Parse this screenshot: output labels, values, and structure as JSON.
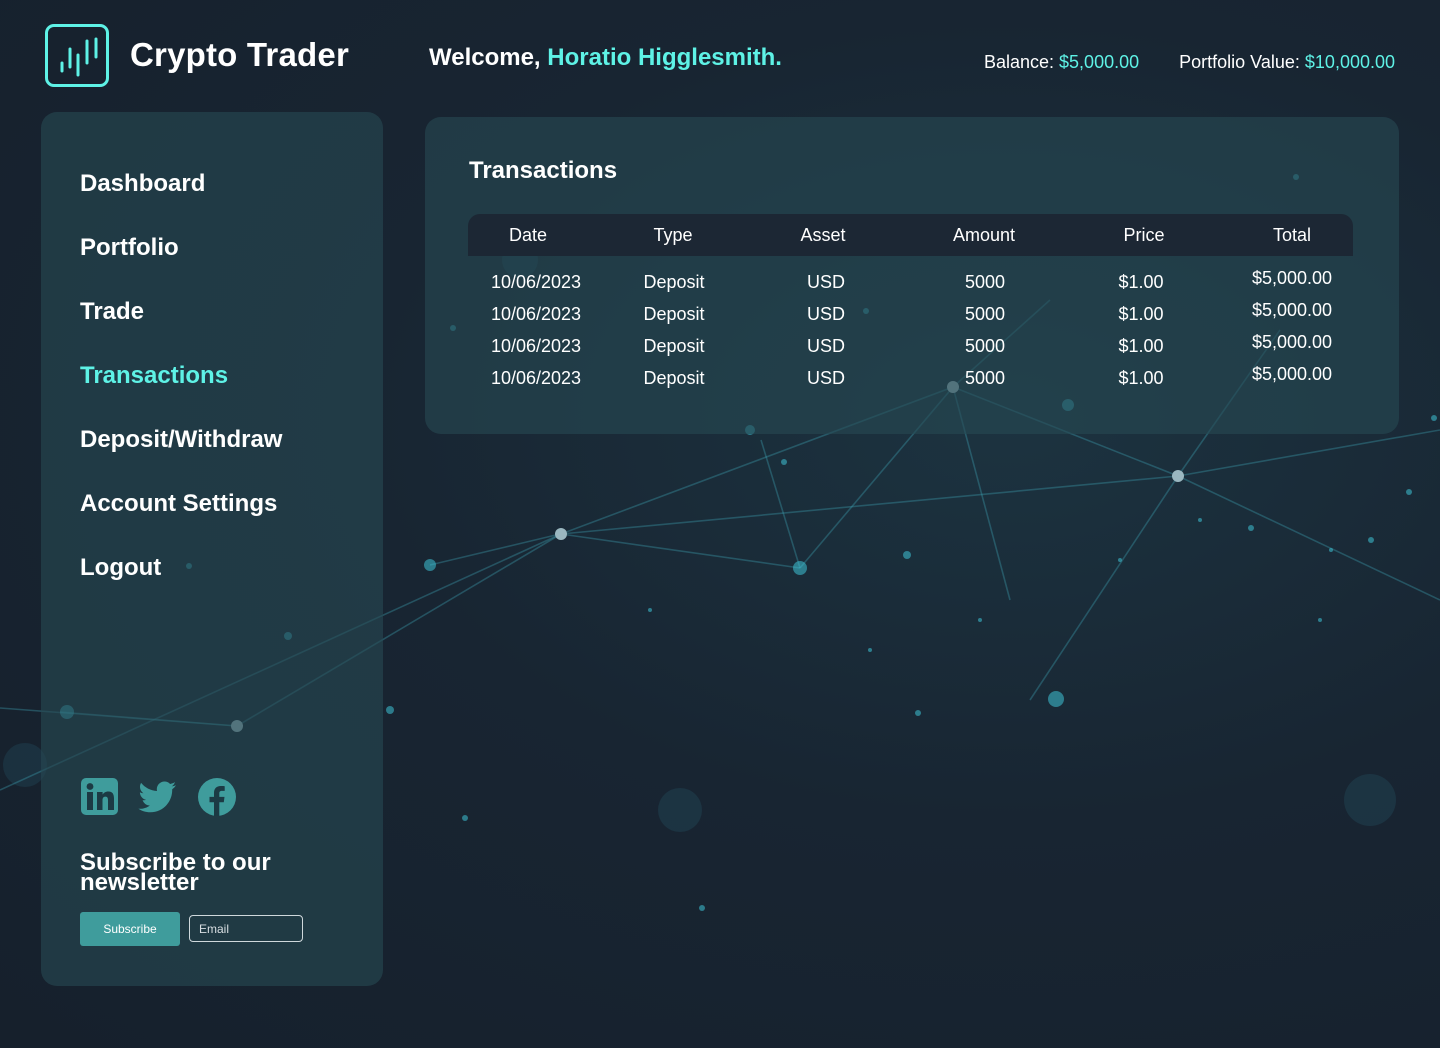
{
  "app": {
    "title": "Crypto Trader",
    "logo_icon": "candlestick-chart-icon"
  },
  "header": {
    "welcome_prefix": "Welcome,",
    "user_name": "Horatio Higglesmith.",
    "balance_label": "Balance:",
    "balance_value": "$5,000.00",
    "portfolio_label": "Portfolio Value:",
    "portfolio_value": "$10,000.00"
  },
  "colors": {
    "accent": "#5ef2e6",
    "button": "#3f9c9c",
    "background": "#17222f",
    "panel": "#264852",
    "table_header": "#1c2734"
  },
  "sidebar": {
    "items": [
      {
        "label": "Dashboard",
        "active": false
      },
      {
        "label": "Portfolio",
        "active": false
      },
      {
        "label": "Trade",
        "active": false
      },
      {
        "label": "Transactions",
        "active": true
      },
      {
        "label": "Deposit/Withdraw",
        "active": false
      },
      {
        "label": "Account Settings",
        "active": false
      },
      {
        "label": "Logout",
        "active": false
      }
    ],
    "social_icons": [
      "linkedin-icon",
      "twitter-icon",
      "facebook-icon"
    ],
    "newsletter": {
      "title": "Subscribe to our newsletter",
      "button_label": "Subscribe",
      "email_placeholder": "Email",
      "email_value": ""
    }
  },
  "transactions": {
    "title": "Transactions",
    "columns": [
      "Date",
      "Type",
      "Asset",
      "Amount",
      "Price",
      "Total"
    ],
    "rows": [
      [
        "10/06/2023",
        "Deposit",
        "USD",
        "5000",
        "$1.00",
        "$5,000.00"
      ],
      [
        "10/06/2023",
        "Deposit",
        "USD",
        "5000",
        "$1.00",
        "$5,000.00"
      ],
      [
        "10/06/2023",
        "Deposit",
        "USD",
        "5000",
        "$1.00",
        "$5,000.00"
      ],
      [
        "10/06/2023",
        "Deposit",
        "USD",
        "5000",
        "$1.00",
        "$5,000.00"
      ]
    ]
  }
}
